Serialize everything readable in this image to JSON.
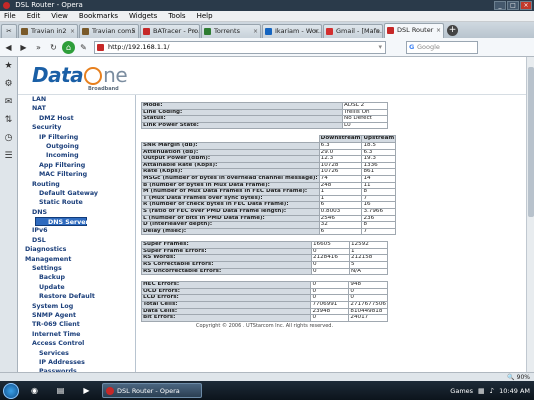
{
  "window": {
    "title": "DSL Router - Opera"
  },
  "menubar": [
    "File",
    "Edit",
    "View",
    "Bookmarks",
    "Widgets",
    "Tools",
    "Help"
  ],
  "tabs": [
    {
      "label": "Travian in2",
      "color": "#7a5a2a"
    },
    {
      "label": "Travian com5",
      "color": "#7a5a2a"
    },
    {
      "label": "BATracer - Pro...",
      "color": "#c62828"
    },
    {
      "label": "Torrents",
      "color": "#2e7d32"
    },
    {
      "label": "Ikariam - Wor...",
      "color": "#1565c0"
    },
    {
      "label": "Gmail - [Mafe...",
      "color": "#d32f2f"
    },
    {
      "label": "DSL Router",
      "color": "#c62828"
    }
  ],
  "address": {
    "url": "http://192.168.1.1/",
    "search_placeholder": "Google"
  },
  "brand": {
    "logo_part1": "Data",
    "logo_part2": "ne",
    "sub": "Broadband"
  },
  "sidebar": [
    {
      "label": "LAN",
      "level": 1
    },
    {
      "label": "NAT",
      "level": 1
    },
    {
      "label": "DMZ Host",
      "level": 2
    },
    {
      "label": "Security",
      "level": 1
    },
    {
      "label": "IP Filtering",
      "level": 2
    },
    {
      "label": "Outgoing",
      "level": 3
    },
    {
      "label": "Incoming",
      "level": 3
    },
    {
      "label": "App Filtering",
      "level": 2
    },
    {
      "label": "MAC Filtering",
      "level": 2
    },
    {
      "label": "Routing",
      "level": 1
    },
    {
      "label": "Default Gateway",
      "level": 2
    },
    {
      "label": "Static Route",
      "level": 2
    },
    {
      "label": "DNS",
      "level": 1
    },
    {
      "label": "DNS Server",
      "level": 2,
      "selected": true
    },
    {
      "label": "IPv6",
      "level": 1
    },
    {
      "label": "DSL",
      "level": 1
    },
    {
      "label": "Diagnostics",
      "level": 0
    },
    {
      "label": "Management",
      "level": 0
    },
    {
      "label": "Settings",
      "level": 1
    },
    {
      "label": "Backup",
      "level": 2
    },
    {
      "label": "Update",
      "level": 2
    },
    {
      "label": "Restore Default",
      "level": 2
    },
    {
      "label": "System Log",
      "level": 1
    },
    {
      "label": "SNMP Agent",
      "level": 1
    },
    {
      "label": "TR-069 Client",
      "level": 1
    },
    {
      "label": "Internet Time",
      "level": 1
    },
    {
      "label": "Access Control",
      "level": 1
    },
    {
      "label": "Services",
      "level": 2
    },
    {
      "label": "IP Addresses",
      "level": 2
    },
    {
      "label": "Passwords",
      "level": 2
    }
  ],
  "status_table": [
    {
      "label": "Mode:",
      "value": "ADSL 2"
    },
    {
      "label": "Line Coding:",
      "value": "Trellis On"
    },
    {
      "label": "Status:",
      "value": "No Defect"
    },
    {
      "label": "Link Power State:",
      "value": "L0"
    }
  ],
  "stats_header": {
    "downstream": "Downstream",
    "upstream": "Upstream"
  },
  "stats_table": [
    {
      "label": "SNR Margin (dB):",
      "down": "6.3",
      "up": "18.5"
    },
    {
      "label": "Attenuation (dB):",
      "down": "29.0",
      "up": "6.3"
    },
    {
      "label": "Output Power (dBm):",
      "down": "12.3",
      "up": "19.3"
    },
    {
      "label": "Attainable Rate (Kbps):",
      "down": "10728",
      "up": "1336"
    },
    {
      "label": "Rate (Kbps):",
      "down": "10726",
      "up": "861"
    },
    {
      "label": "MSGc (number of bytes in overhead channel message):",
      "down": "74",
      "up": "14"
    },
    {
      "label": "B (number of bytes in Mux Data Frame):",
      "down": "248",
      "up": "11"
    },
    {
      "label": "M (number of Mux Data Frames in FEC Data Frame):",
      "down": "1",
      "up": "8"
    },
    {
      "label": "T (Mux Data Frames over sync bytes):",
      "down": "1",
      "up": "7"
    },
    {
      "label": "R (number of check bytes in FEC Data Frame):",
      "down": "6",
      "up": "16"
    },
    {
      "label": "S (ratio of FEC over PMD Data Frame length):",
      "down": "0.8003",
      "up": "3.7966"
    },
    {
      "label": "L (number of bits in PMD Data Frame):",
      "down": "2546",
      "up": "236"
    },
    {
      "label": "D (interleaver depth):",
      "down": "32",
      "up": "8"
    },
    {
      "label": "Delay (msec):",
      "down": "6",
      "up": "7"
    }
  ],
  "frames_table": [
    {
      "label": "Super Frames:",
      "down": "16605",
      "up": "12592"
    },
    {
      "label": "Super Frame Errors:",
      "down": "0",
      "up": "1"
    },
    {
      "label": "RS Words:",
      "down": "2128416",
      "up": "212158"
    },
    {
      "label": "RS Correctable Errors:",
      "down": "0",
      "up": "5"
    },
    {
      "label": "RS Uncorrectable Errors:",
      "down": "0",
      "up": "N/A"
    }
  ],
  "errors_table": [
    {
      "label": "HEC Errors:",
      "down": "0",
      "up": "948"
    },
    {
      "label": "OCD Errors:",
      "down": "0",
      "up": "0"
    },
    {
      "label": "LCD Errors:",
      "down": "0",
      "up": "0"
    },
    {
      "label": "Total Cells:",
      "down": "7706991",
      "up": "2717677506"
    },
    {
      "label": "Data Cells:",
      "down": "23948",
      "up": "810449818"
    },
    {
      "label": "Bit Errors:",
      "down": "0",
      "up": "24017"
    }
  ],
  "copyright": "Copyright © 2006 . UTStarcom Inc. All rights reserved.",
  "statusbar": {
    "zoom": "90%"
  },
  "taskbar": {
    "active_task": "DSL Router - Opera",
    "games": "Games",
    "time": "10:49 AM"
  }
}
